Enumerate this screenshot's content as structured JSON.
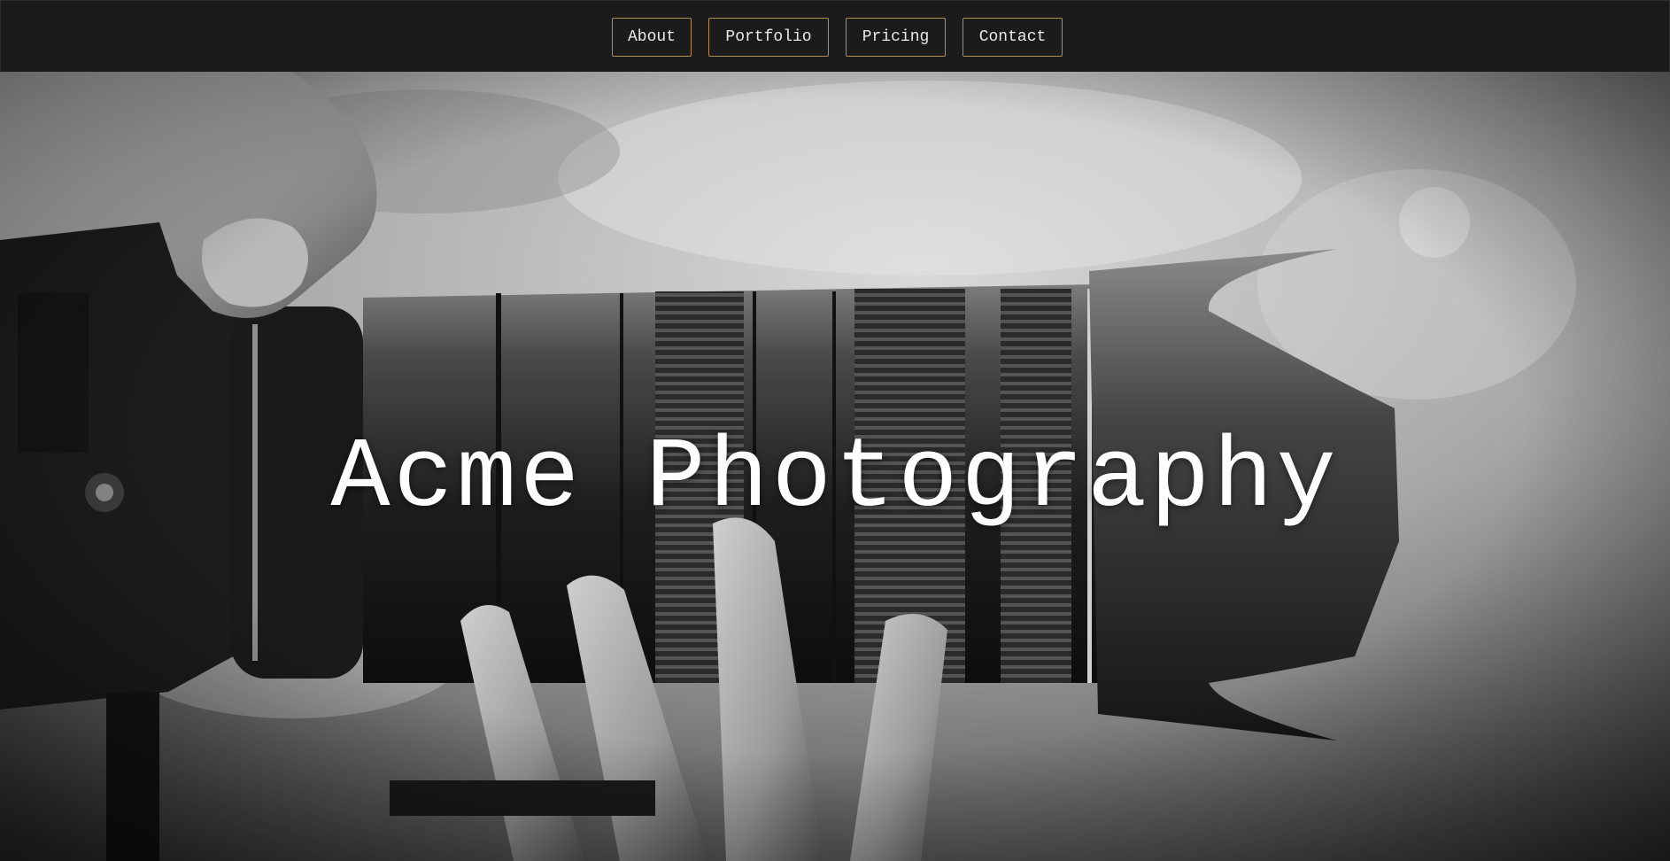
{
  "nav": {
    "items": [
      {
        "label": "About"
      },
      {
        "label": "Portfolio"
      },
      {
        "label": "Pricing"
      },
      {
        "label": "Contact"
      }
    ]
  },
  "hero": {
    "title": "Acme Photography",
    "image": "black-and-white photo of hands holding a camera with a telephoto zoom lens against a cloudy sky"
  },
  "colors": {
    "nav_background": "#1b1b1b",
    "nav_button_border": "#b08d52",
    "nav_text": "#e9e9e9",
    "hero_title": "#ffffff"
  }
}
